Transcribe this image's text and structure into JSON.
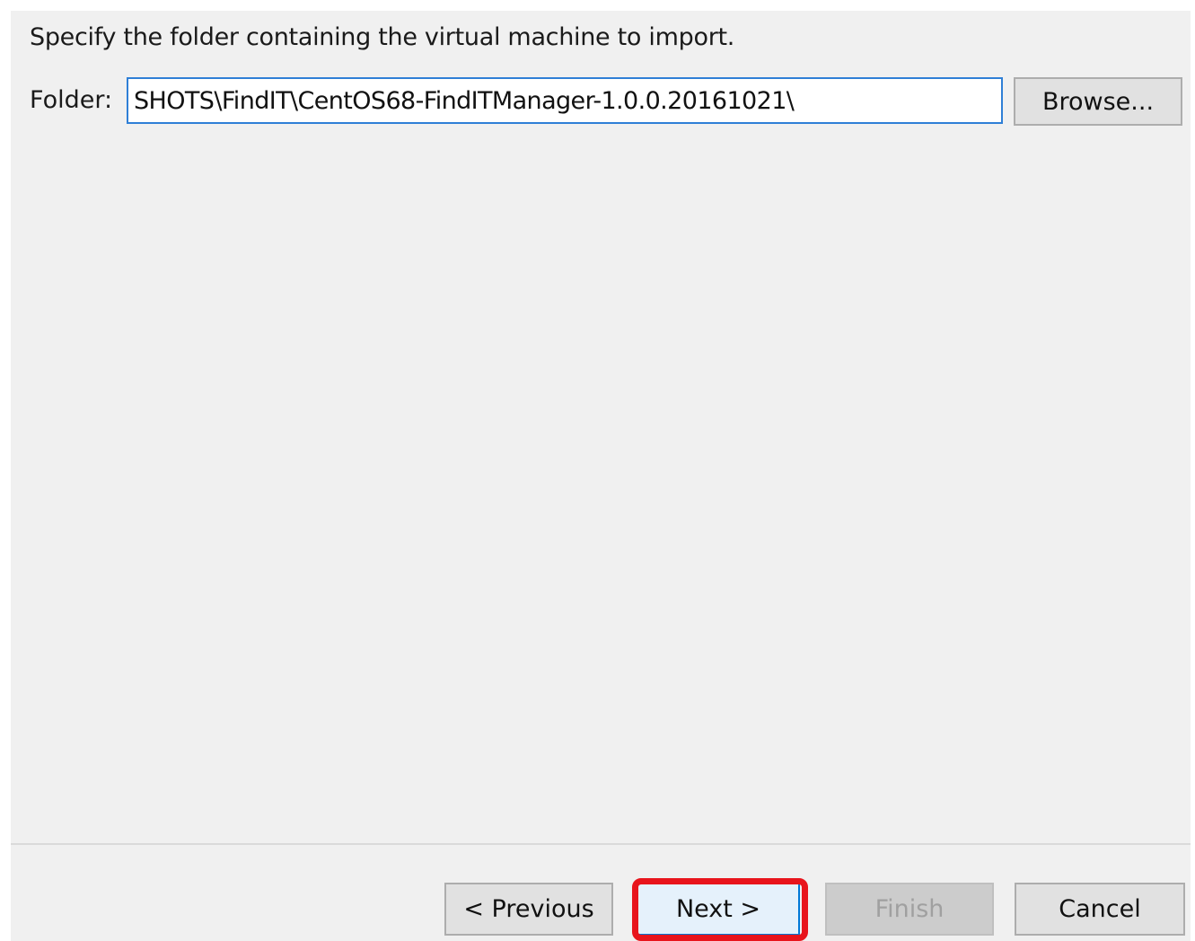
{
  "wizard": {
    "instruction": "Specify the folder containing the virtual machine to import.",
    "folder_label": "Folder:",
    "folder_value": "SHOTS\\FindIT\\CentOS68-FindITManager-1.0.0.20161021\\",
    "browse_label": "Browse..."
  },
  "footer": {
    "previous_label": "< Previous",
    "next_label": "Next >",
    "finish_label": "Finish",
    "cancel_label": "Cancel",
    "highlight_color": "#e8141c"
  }
}
